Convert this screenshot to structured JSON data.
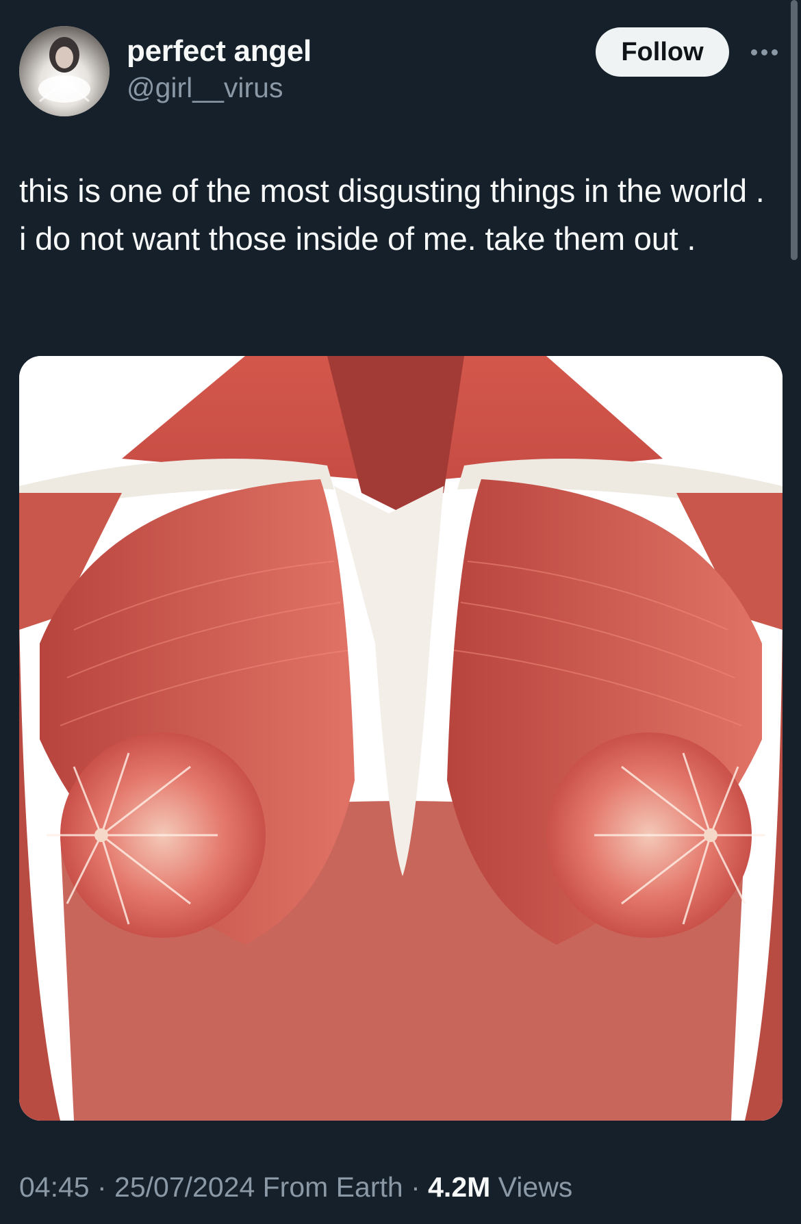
{
  "author": {
    "display_name": "perfect angel",
    "handle": "@girl__virus"
  },
  "follow_label": "Follow",
  "tweet": {
    "text": "this is one of the most disgusting things in the world . i do not want those inside of me. take them out ."
  },
  "meta": {
    "time": "04:45",
    "sep1": " · ",
    "date": "25/07/2024",
    "source": " From Earth",
    "sep2": " · ",
    "views_count": "4.2M",
    "views_label": " Views"
  },
  "icons": {
    "more": "more-horizontal-icon"
  }
}
